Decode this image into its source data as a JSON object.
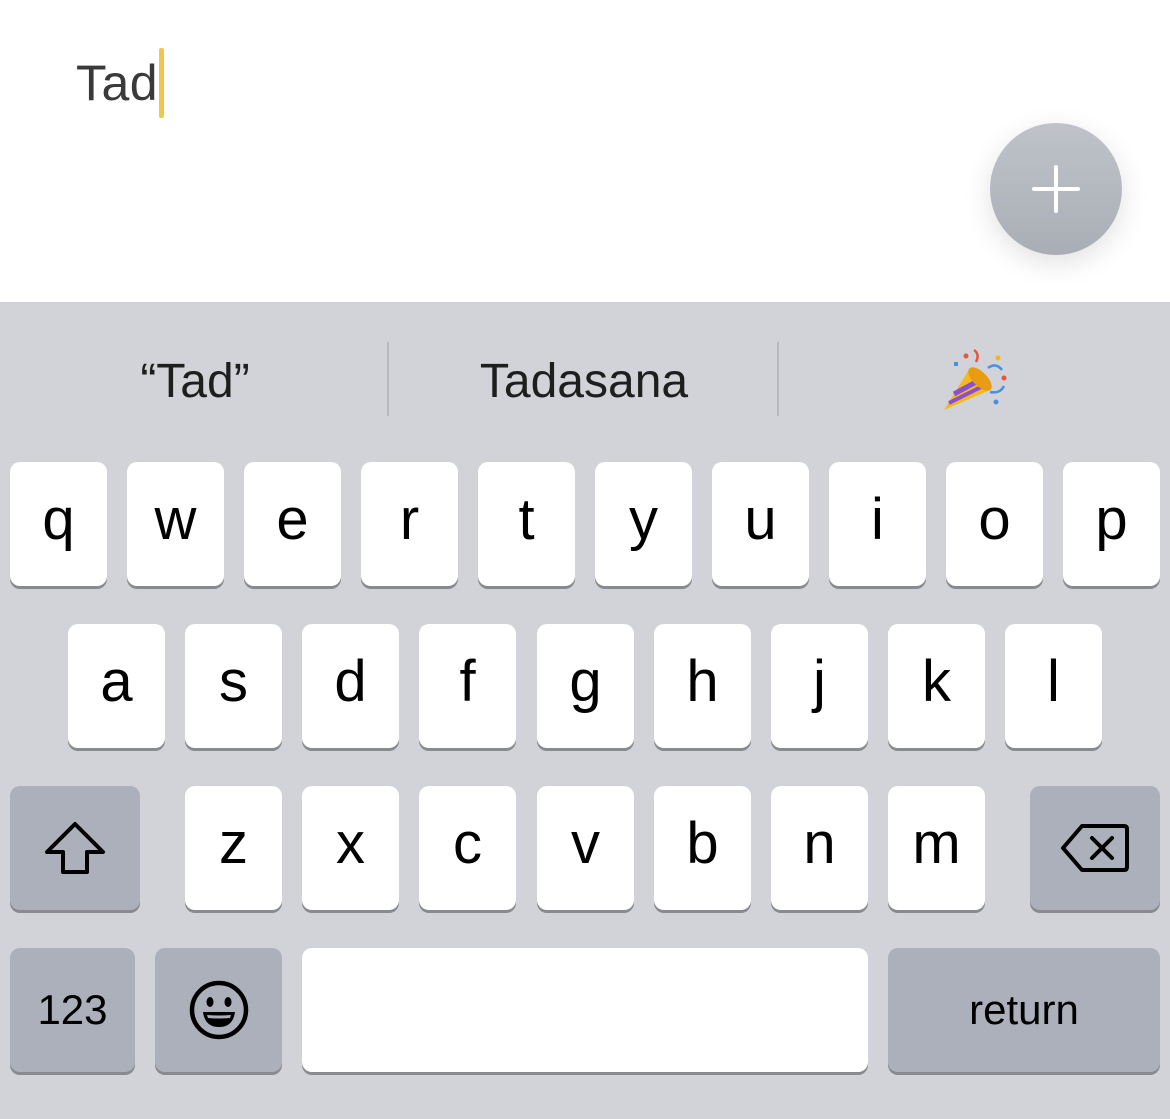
{
  "editor": {
    "input_value": "Tad",
    "caret_color": "#efc84a",
    "add_icon": "plus-icon"
  },
  "suggestions": [
    "“Tad”",
    "Tadasana",
    "🎉"
  ],
  "keyboard": {
    "row1": [
      "q",
      "w",
      "e",
      "r",
      "t",
      "y",
      "u",
      "i",
      "o",
      "p"
    ],
    "row2": [
      "a",
      "s",
      "d",
      "f",
      "g",
      "h",
      "j",
      "k",
      "l"
    ],
    "row3": [
      "z",
      "x",
      "c",
      "v",
      "b",
      "n",
      "m"
    ],
    "shift_icon": "shift-icon",
    "backspace_icon": "backspace-icon",
    "numbers_label": "123",
    "emoji_icon": "emoji-icon",
    "return_label": "return"
  },
  "colors": {
    "keyboard_bg": "#d1d3d9",
    "key_bg": "#ffffff",
    "special_key_bg": "#abb0bb",
    "fab_bg": "#b3b7be"
  }
}
